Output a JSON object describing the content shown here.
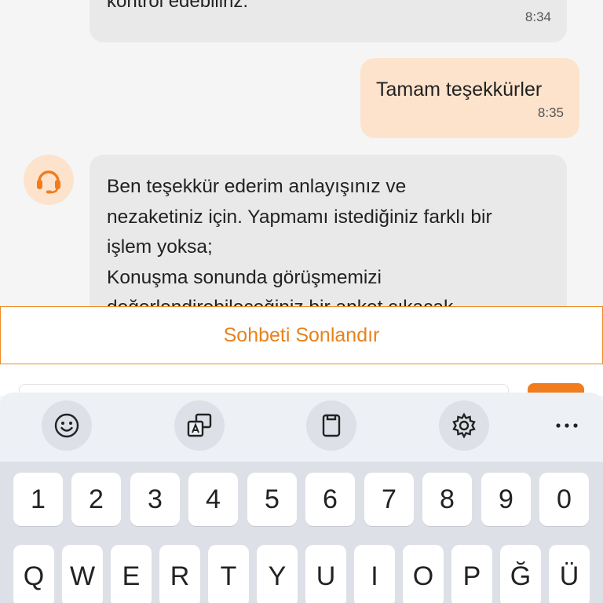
{
  "messages": {
    "agent_top": {
      "partial_text": "kontrol edebiliriz.",
      "time": "8:34"
    },
    "user": {
      "text": "Tamam teşekkürler",
      "time": "8:35"
    },
    "agent": {
      "text": "Ben teşekkür ederim anlayışınız ve\nnezaketiniz için. Yapmamı istediğiniz farklı bir\nişlem yoksa;\nKonuşma sonunda görüşmemizi\ndeğerlendirebileceğiniz bir anket çıkacak"
    }
  },
  "end_chat": {
    "label": "Sohbeti Sonlandır"
  },
  "keyboard": {
    "toolbar": [
      "emoji-icon",
      "translate-icon",
      "clipboard-icon",
      "settings-icon",
      "more-icon"
    ],
    "number_row": [
      "1",
      "2",
      "3",
      "4",
      "5",
      "6",
      "7",
      "8",
      "9",
      "0"
    ],
    "letter_row": [
      "Q",
      "W",
      "E",
      "R",
      "T",
      "Y",
      "U",
      "I",
      "O",
      "P",
      "Ğ",
      "Ü"
    ]
  },
  "colors": {
    "accent": "#f07c1e",
    "user_bubble": "#fde3cc",
    "agent_bubble": "#e9e9e9"
  }
}
